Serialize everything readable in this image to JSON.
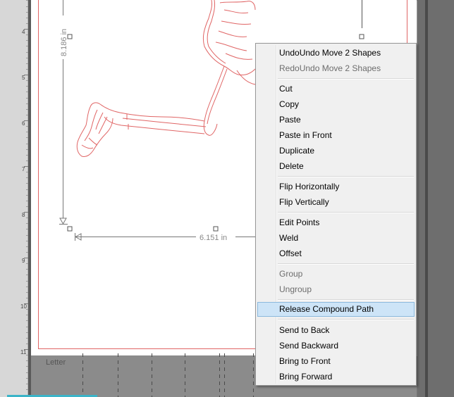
{
  "ruler": {
    "labels": [
      "4",
      "5",
      "6",
      "7",
      "8",
      "9",
      "10",
      "11"
    ]
  },
  "canvas": {
    "height_dimension": "8.186 in",
    "width_dimension": "6.151 in",
    "outline_color": "#e06565",
    "mat_label": "Letter"
  },
  "context_menu": {
    "undo": "UndoUndo Move 2 Shapes",
    "redo": "RedoUndo Move 2 Shapes",
    "cut": "Cut",
    "copy": "Copy",
    "paste": "Paste",
    "paste_in_front": "Paste in Front",
    "duplicate": "Duplicate",
    "delete": "Delete",
    "flip_horizontally": "Flip Horizontally",
    "flip_vertically": "Flip Vertically",
    "edit_points": "Edit Points",
    "weld": "Weld",
    "offset": "Offset",
    "group": "Group",
    "ungroup": "Ungroup",
    "release_compound_path": "Release Compound Path",
    "send_to_back": "Send to Back",
    "send_backward": "Send Backward",
    "bring_to_front": "Bring to Front",
    "bring_forward": "Bring Forward"
  },
  "colors": {
    "highlight": "#cde4f7",
    "accent": "#3bb4c8"
  }
}
